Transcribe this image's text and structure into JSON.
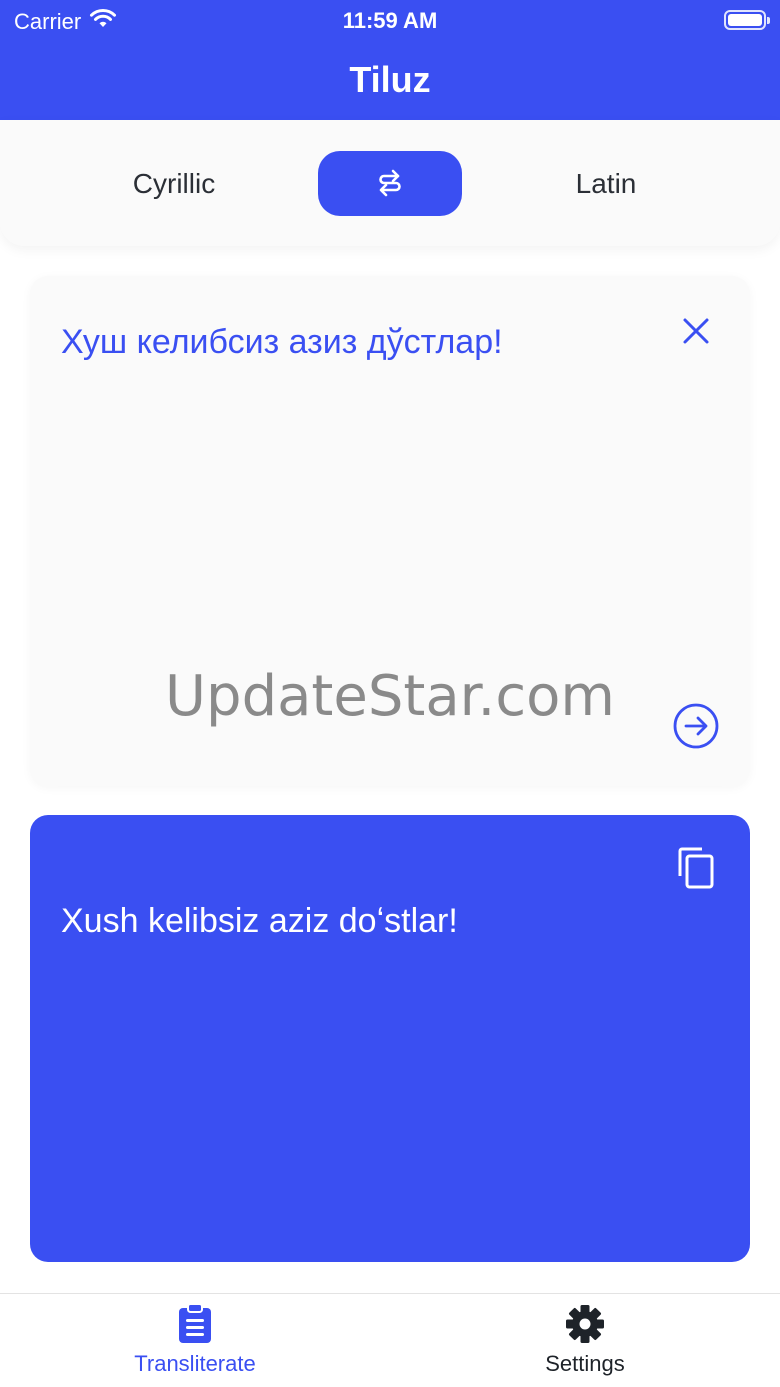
{
  "status_bar": {
    "carrier": "Carrier",
    "time": "11:59 AM"
  },
  "nav": {
    "title": "Tiluz"
  },
  "language_switch": {
    "source": "Cyrillic",
    "target": "Latin"
  },
  "input": {
    "text": "Хуш келибсиз азиз дўстлар!"
  },
  "output": {
    "text": "Xush kelibsiz aziz doʻstlar!"
  },
  "watermark": "UpdateStar.com",
  "tabs": [
    {
      "label": "Transliterate",
      "icon": "clipboard-list-icon",
      "active": true
    },
    {
      "label": "Settings",
      "icon": "gear-icon",
      "active": false
    }
  ],
  "colors": {
    "accent": "#3a4ff2",
    "card_bg": "#fafafa",
    "text_dark": "#2b2f36"
  }
}
